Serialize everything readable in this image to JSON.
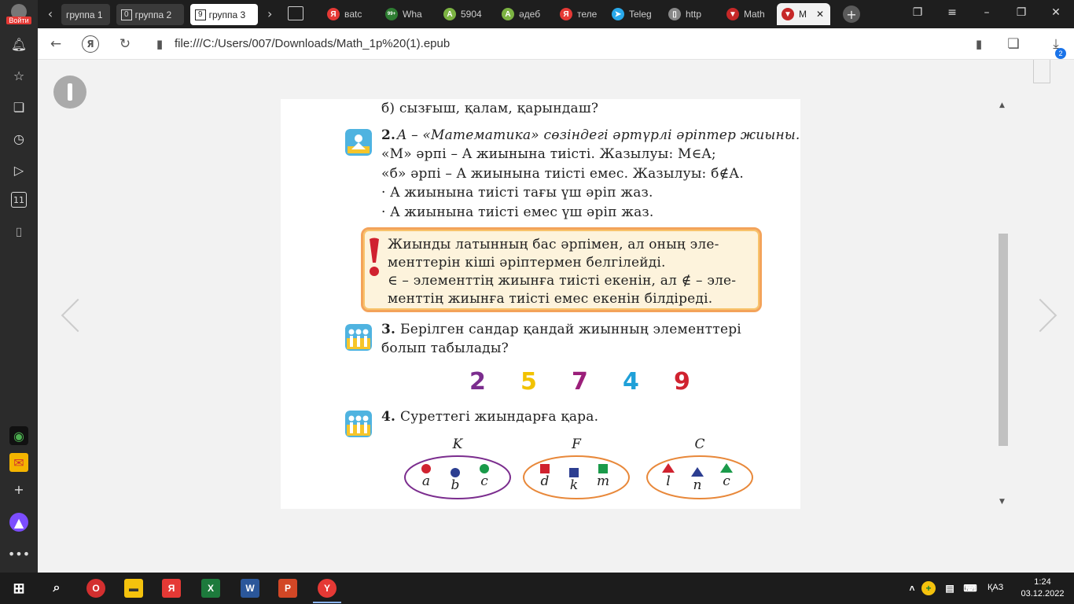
{
  "sidebar_login_label": "Войти",
  "tab_groups": [
    {
      "label": "группа 1",
      "num": ""
    },
    {
      "label": "группа 2",
      "num": "0"
    },
    {
      "label": "группа 3",
      "num": "9"
    }
  ],
  "tabs": [
    {
      "label": "вatc",
      "icon": "yandex-icon",
      "color": "#e53935",
      "glyph": "Я"
    },
    {
      "label": "Wha",
      "icon": "whatsapp-icon",
      "color": "#2e7d32",
      "glyph": "99+"
    },
    {
      "label": "5904",
      "icon": "app-a-icon",
      "color": "#7cb342",
      "glyph": "A"
    },
    {
      "label": "әдеб",
      "icon": "app-a-icon",
      "color": "#7cb342",
      "glyph": "A"
    },
    {
      "label": "теле",
      "icon": "yandex-icon",
      "color": "#e53935",
      "glyph": "Я"
    },
    {
      "label": "Teleg",
      "icon": "telegram-icon",
      "color": "#29a9eb",
      "glyph": "➤"
    },
    {
      "label": "http",
      "icon": "page-icon",
      "color": "#888888",
      "glyph": "▯"
    },
    {
      "label": "Math",
      "icon": "epub-icon",
      "color": "#c62828",
      "glyph": "▼"
    },
    {
      "label": "M",
      "icon": "epub-icon",
      "color": "#c62828",
      "glyph": "▼"
    }
  ],
  "address": {
    "url": "file:///C:/Users/007/Downloads/Math_1p%20(1).epub",
    "download_count": "2"
  },
  "book": {
    "line_b": "б) сызғыш, қалам, қарындаш?",
    "task2_num": "2.",
    "task2_lines": [
      "A – «Математика» сөзіндегі әртүрлі әріптер жиыны.",
      "«М» әрпі – A жиынына тиісті. Жазылуы: М∈A;",
      "«б» әрпі – A жиынына тиісті емес. Жазылуы: б∉А."
    ],
    "bullets": [
      "·  A жиынына тиісті тағы үш әріп жаз.",
      "·  A жиынына тиісті емес үш әріп жаз."
    ],
    "note_lines": [
      "Жиынды латынның бас әрпімен, ал оның эле-",
      "менттерін кіші әріптермен белгілейді.",
      "∈ – элементтің жиынға тиісті екенін, ал ∉ – эле-",
      "менттің жиынға тиісті емес екенін білдіреді."
    ],
    "task3_num": "3.",
    "task3_lines": [
      "Берілген сандар қандай жиынның элементтері",
      "болып табылады?"
    ],
    "numbers": [
      {
        "value": "2",
        "color": "#7b2d8e"
      },
      {
        "value": "5",
        "color": "#f2c200"
      },
      {
        "value": "7",
        "color": "#9b1f7a"
      },
      {
        "value": "4",
        "color": "#1fa0d8"
      },
      {
        "value": "9",
        "color": "#d0222f"
      }
    ],
    "task4_num": "4.",
    "task4_line": "Суреттегі жиындарға қара.",
    "sets": [
      {
        "name": "K",
        "border": "#7b2d8e",
        "items": [
          {
            "shape": "circle",
            "color": "#d0222f",
            "label": "a"
          },
          {
            "shape": "circle",
            "color": "#2c3e91",
            "label": "b"
          },
          {
            "shape": "circle",
            "color": "#1a9a4a",
            "label": "c"
          }
        ]
      },
      {
        "name": "F",
        "border": "#e8883a",
        "items": [
          {
            "shape": "square",
            "color": "#d0222f",
            "label": "d"
          },
          {
            "shape": "square",
            "color": "#2c3e91",
            "label": "k"
          },
          {
            "shape": "square",
            "color": "#1a9a4a",
            "label": "m"
          }
        ]
      },
      {
        "name": "C",
        "border": "#e8883a",
        "items": [
          {
            "shape": "triangle",
            "color": "#d0222f",
            "label": "l"
          },
          {
            "shape": "triangle",
            "color": "#2c3e91",
            "label": "n"
          },
          {
            "shape": "triangle",
            "color": "#1a9a4a",
            "label": "c"
          }
        ]
      }
    ]
  },
  "taskbar": {
    "lang": "ҚАЗ",
    "time": "1:24",
    "date": "03.12.2022"
  }
}
